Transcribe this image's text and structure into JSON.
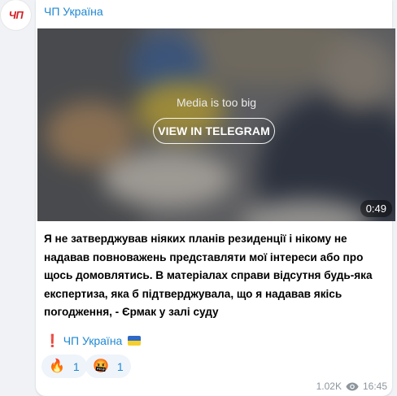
{
  "channel": {
    "avatar_text": "ЧП",
    "name": "ЧП Україна"
  },
  "media": {
    "notice": "Media is too big",
    "button_label": "VIEW IN TELEGRAM",
    "duration": "0:49"
  },
  "message": {
    "text": "Я не затверджував ніяких планів резиденції і нікому не надавав повноважень представляти мої інтереси або про щось домовлятись. В матеріалах справи відсутня будь-яка експертиза, яка б підтверджувала, що я надавав якісь погодження, - Єрмак у залі суду",
    "signature_mark": "❗️",
    "signature_link": "ЧП Україна",
    "signature_flag_icon": "ukraine-flag-icon"
  },
  "reactions": [
    {
      "emoji": "🔥",
      "icon": "fire-icon",
      "count": "1"
    },
    {
      "emoji": "🤬",
      "icon": "cursing-face-icon",
      "count": "1"
    }
  ],
  "footer": {
    "views": "1.02K",
    "views_icon": "eye-icon",
    "time": "16:45"
  },
  "colors": {
    "accent": "#1e88d3",
    "logo_red": "#d51f26",
    "reaction_bg": "#eef4fa",
    "meta_gray": "#8d969e"
  }
}
